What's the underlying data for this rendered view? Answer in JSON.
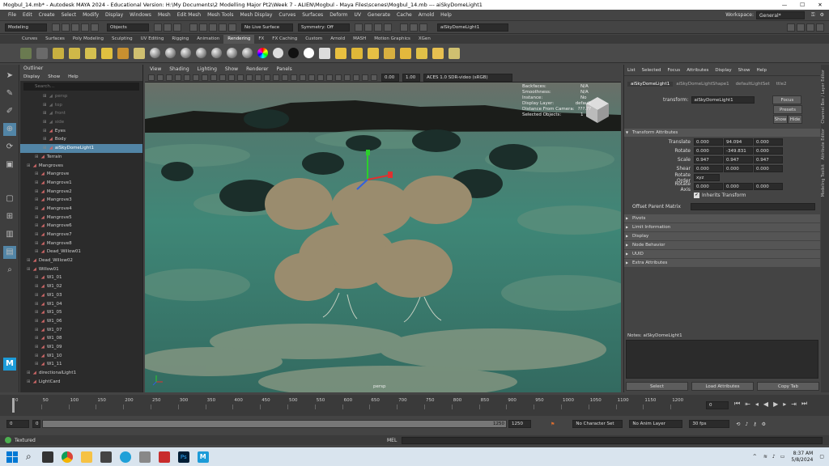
{
  "window": {
    "title": "Mogbul_14.mb* - Autodesk MAYA 2024 - Educational Version: H:\\My Documents\\2 Modelling Major Pt2\\Week 7 - ALIEN\\Mogbul - Maya Files\\scenes\\Mogbul_14.mb   ---   aiSkyDomeLight1",
    "minimize": "—",
    "maximize": "☐",
    "close": "✕"
  },
  "menubar": {
    "items": [
      "File",
      "Edit",
      "Create",
      "Select",
      "Modify",
      "Display",
      "Windows",
      "Mesh",
      "Edit Mesh",
      "Mesh Tools",
      "Mesh Display",
      "Curves",
      "Surfaces",
      "Deform",
      "UV",
      "Generate",
      "Cache",
      "Arnold",
      "Help"
    ],
    "workspace_label": "Workspace:",
    "workspace_value": "General*"
  },
  "statusline": {
    "mode": "Modeling",
    "objects": "Objects",
    "live_surface": "No Live Surface",
    "symmetry": "Symmetry: Off",
    "name_field": "aiSkyDomeLight1"
  },
  "shelf": {
    "tabs": [
      "Curves",
      "Surfaces",
      "Poly Modeling",
      "Sculpting",
      "UV Editing",
      "Rigging",
      "Animation",
      "Rendering",
      "FX",
      "FX Caching",
      "Custom",
      "Arnold",
      "MASH",
      "Motion Graphics",
      "XGen"
    ],
    "active_tab": "Rendering"
  },
  "outliner": {
    "title": "Outliner",
    "menu": [
      "Display",
      "Show",
      "Help"
    ],
    "search_placeholder": "Search...",
    "items": [
      {
        "label": "persp",
        "indent": 2,
        "state": "dim"
      },
      {
        "label": "top",
        "indent": 2,
        "state": "dim"
      },
      {
        "label": "front",
        "indent": 2,
        "state": "dim"
      },
      {
        "label": "side",
        "indent": 2,
        "state": "dim"
      },
      {
        "label": "Eyes",
        "indent": 2,
        "state": "normal"
      },
      {
        "label": "Body",
        "indent": 2,
        "state": "normal"
      },
      {
        "label": "aiSkyDomeLight1",
        "indent": 2,
        "state": "selected"
      },
      {
        "label": "Terrain",
        "indent": 1,
        "state": "normal"
      },
      {
        "label": "Mangroves",
        "indent": 0,
        "state": "normal"
      },
      {
        "label": "Mangrove",
        "indent": 1,
        "state": "normal"
      },
      {
        "label": "Mangrove1",
        "indent": 1,
        "state": "normal"
      },
      {
        "label": "Mangrove2",
        "indent": 1,
        "state": "normal"
      },
      {
        "label": "Mangrove3",
        "indent": 1,
        "state": "normal"
      },
      {
        "label": "Mangrove4",
        "indent": 1,
        "state": "normal"
      },
      {
        "label": "Mangrove5",
        "indent": 1,
        "state": "normal"
      },
      {
        "label": "Mangrove6",
        "indent": 1,
        "state": "normal"
      },
      {
        "label": "Mangrove7",
        "indent": 1,
        "state": "normal"
      },
      {
        "label": "Mangrove8",
        "indent": 1,
        "state": "normal"
      },
      {
        "label": "Dead_Willow01",
        "indent": 1,
        "state": "normal"
      },
      {
        "label": "Dead_Willow02",
        "indent": 0,
        "state": "normal"
      },
      {
        "label": "Willow01",
        "indent": 0,
        "state": "normal"
      },
      {
        "label": "W1_01",
        "indent": 1,
        "state": "normal"
      },
      {
        "label": "W1_02",
        "indent": 1,
        "state": "normal"
      },
      {
        "label": "W1_03",
        "indent": 1,
        "state": "normal"
      },
      {
        "label": "W1_04",
        "indent": 1,
        "state": "normal"
      },
      {
        "label": "W1_05",
        "indent": 1,
        "state": "normal"
      },
      {
        "label": "W1_06",
        "indent": 1,
        "state": "normal"
      },
      {
        "label": "W1_07",
        "indent": 1,
        "state": "normal"
      },
      {
        "label": "W1_08",
        "indent": 1,
        "state": "normal"
      },
      {
        "label": "W1_09",
        "indent": 1,
        "state": "normal"
      },
      {
        "label": "W1_10",
        "indent": 1,
        "state": "normal"
      },
      {
        "label": "W1_11",
        "indent": 1,
        "state": "normal"
      },
      {
        "label": "directionalLight1",
        "indent": 0,
        "state": "normal"
      },
      {
        "label": "LightCard",
        "indent": 0,
        "state": "normal"
      }
    ]
  },
  "viewport": {
    "menu": [
      "View",
      "Shading",
      "Lighting",
      "Show",
      "Renderer",
      "Panels"
    ],
    "exposure": "0.00",
    "gamma": "1.00",
    "colorspace": "ACES 1.0 SDR-video (sRGB)",
    "hud": [
      {
        "label": "Backfaces:",
        "value": "N/A"
      },
      {
        "label": "Smoothness:",
        "value": "N/A"
      },
      {
        "label": "Instance:",
        "value": "No"
      },
      {
        "label": "Display Layer:",
        "value": "default"
      },
      {
        "label": "Distance From Camera:",
        "value": "???.??"
      },
      {
        "label": "Selected Objects:",
        "value": "1"
      }
    ],
    "camera_label": "persp"
  },
  "attribute_editor": {
    "menu": [
      "List",
      "Selected",
      "Focus",
      "Attributes",
      "Display",
      "Show",
      "Help"
    ],
    "tabs": [
      "aiSkyDomeLight1",
      "aiSkyDomeLightShape1",
      "defaultLightSet",
      "ttle2"
    ],
    "transform_label": "transform:",
    "transform_value": "aiSkyDomeLight1",
    "focus_btn": "Focus",
    "presets_btn": "Presets",
    "show_btn": "Show",
    "hide_btn": "Hide",
    "section_transform": "Transform Attributes",
    "rows": [
      {
        "label": "Translate",
        "values": [
          "0.000",
          "94.094",
          "0.000"
        ]
      },
      {
        "label": "Rotate",
        "values": [
          "0.000",
          "-349.831",
          "0.000"
        ]
      },
      {
        "label": "Scale",
        "values": [
          "0.947",
          "0.947",
          "0.947"
        ]
      },
      {
        "label": "Shear",
        "values": [
          "0.000",
          "0.000",
          "0.000"
        ]
      }
    ],
    "rotate_order_label": "Rotate Order",
    "rotate_order_value": "xyz",
    "rotate_axis_label": "Rotate Axis",
    "rotate_axis_values": [
      "0.000",
      "0.000",
      "0.000"
    ],
    "inherits_label": "Inherits Transform",
    "offset_label": "Offset Parent Matrix",
    "sections": [
      "Pivots",
      "Limit Information",
      "Display",
      "Node Behavior",
      "UUID",
      "Extra Attributes"
    ],
    "notes_label": "Notes: aiSkyDomeLight1",
    "buttons": [
      "Select",
      "Load Attributes",
      "Copy Tab"
    ]
  },
  "side_tabs": [
    "Channel Box / Layer Editor",
    "Attribute Editor",
    "Modeling Toolkit"
  ],
  "timeline": {
    "ticks": [
      "0",
      "50",
      "100",
      "150",
      "200",
      "250",
      "300",
      "350",
      "400",
      "450",
      "500",
      "550",
      "600",
      "650",
      "700",
      "750",
      "800",
      "850",
      "900",
      "950",
      "1000",
      "1050",
      "1100",
      "1150",
      "1200"
    ],
    "current_frame": "0"
  },
  "range": {
    "start": "0",
    "inner_start": "0",
    "inner_end": "1250",
    "end": "1250",
    "character_set": "No Character Set",
    "anim_layer": "No Anim Layer",
    "fps": "30 fps"
  },
  "cmdline": {
    "label": "MEL",
    "help": "Textured"
  },
  "taskbar": {
    "search_icon": "⌕",
    "time": "8:37 AM",
    "date": "5/8/2024"
  }
}
